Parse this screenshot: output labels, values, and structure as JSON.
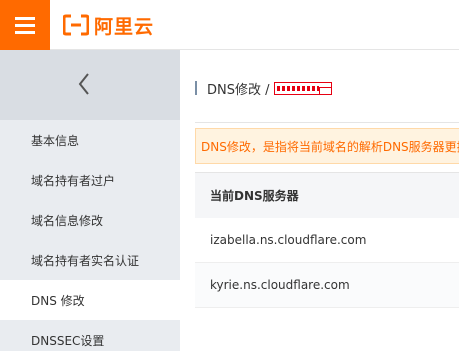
{
  "header": {
    "menu_icon": "hamburger-menu-icon",
    "logo_text": "阿里云",
    "brand_color": "#ff6a00"
  },
  "sidebar": {
    "collapse_icon": "chevron-left-icon",
    "items": [
      {
        "label": "基本信息",
        "active": false
      },
      {
        "label": "域名持有者过户",
        "active": false
      },
      {
        "label": "域名信息修改",
        "active": false
      },
      {
        "label": "域名持有者实名认证",
        "active": false
      },
      {
        "label": "DNS 修改",
        "active": true
      },
      {
        "label": "DNSSEC设置",
        "active": false
      }
    ]
  },
  "main": {
    "breadcrumb": {
      "current": "DNS修改 /"
    },
    "notice": "DNS修改，是指将当前域名的解析DNS服务器更换",
    "table": {
      "header": "当前DNS服务器",
      "rows": [
        "izabella.ns.cloudflare.com",
        "kyrie.ns.cloudflare.com"
      ]
    }
  }
}
